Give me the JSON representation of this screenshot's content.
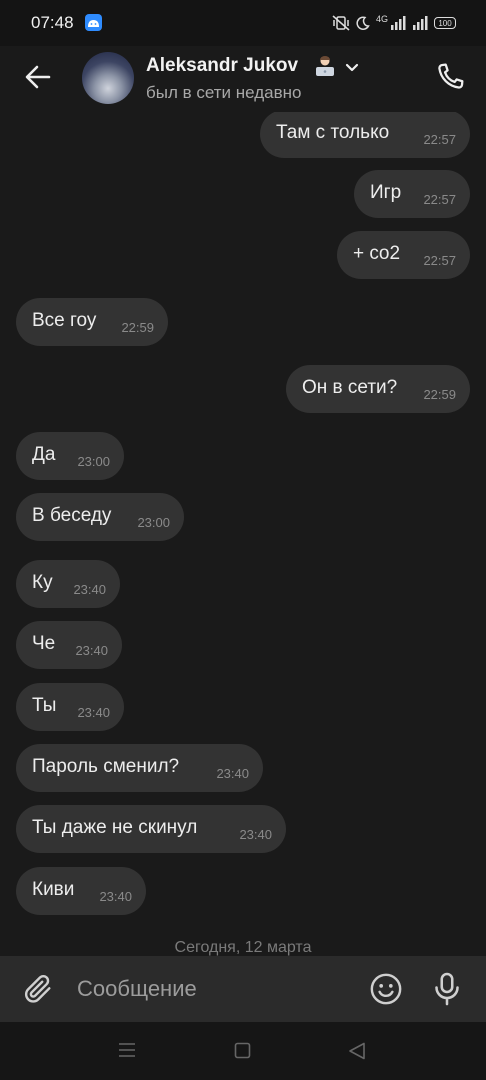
{
  "status_bar": {
    "time": "07:48",
    "network": "4G",
    "battery": "100"
  },
  "header": {
    "contact_name": "Aleksandr Jukov",
    "contact_status": "был в сети недавно",
    "icons": [
      "back-arrow-icon",
      "emoji-person-laptop-icon",
      "chevron-down-icon",
      "phone-icon"
    ]
  },
  "messages": [
    {
      "text": "Там с только",
      "time": "22:57",
      "side": "out"
    },
    {
      "text": "Игр",
      "time": "22:57",
      "side": "out"
    },
    {
      "text": "+ co2",
      "time": "22:57",
      "side": "out"
    },
    {
      "text": "Все гоу",
      "time": "22:59",
      "side": "in"
    },
    {
      "text": "Он в сети?",
      "time": "22:59",
      "side": "out"
    },
    {
      "text": "Да",
      "time": "23:00",
      "side": "in"
    },
    {
      "text": "В беседу",
      "time": "23:00",
      "side": "in"
    },
    {
      "text": "Ку",
      "time": "23:40",
      "side": "in"
    },
    {
      "text": "Че",
      "time": "23:40",
      "side": "in"
    },
    {
      "text": "Ты",
      "time": "23:40",
      "side": "in"
    },
    {
      "text": "Пароль сменил?",
      "time": "23:40",
      "side": "in"
    },
    {
      "text": "Ты даже не скинул",
      "time": "23:40",
      "side": "in"
    },
    {
      "text": "Киви",
      "time": "23:40",
      "side": "in"
    }
  ],
  "date_separator": "Сегодня, 12 марта",
  "composer": {
    "placeholder": "Сообщение"
  },
  "colors": {
    "background": "#1a1a1a",
    "bubble": "#333333",
    "composer": "#2b2b2b"
  }
}
